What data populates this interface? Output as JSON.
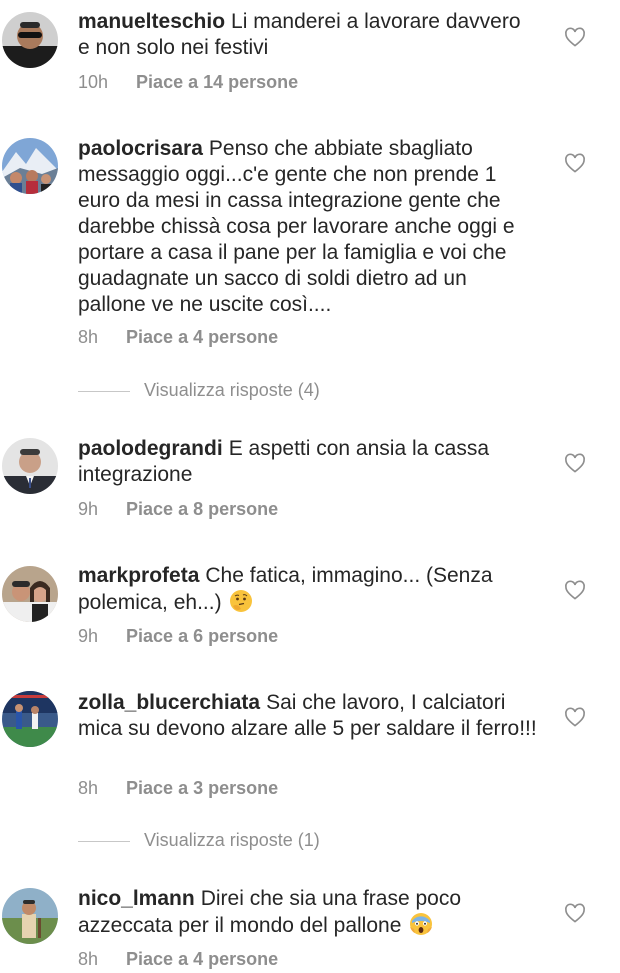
{
  "comments": [
    {
      "username": "manuelteschio",
      "text": "Li manderei a lavorare davvero e non solo nei festivi",
      "time": "10h",
      "likes": "Piace a 14 persone",
      "avatar_icon": "avatar-man-sunglasses"
    },
    {
      "username": "paolocrisara",
      "text": "Penso che abbiate sbagliato messaggio oggi...c'e gente che non prende 1 euro da mesi in cassa integrazione gente che darebbe chissà cosa per lavorare anche oggi e portare a casa il pane per la famiglia e voi che guadagnate un sacco di soldi dietro ad un pallone ve ne uscite così....",
      "time": "8h",
      "likes": "Piace a 4 persone",
      "replies": "Visualizza risposte (4)",
      "avatar_icon": "avatar-mountain-group"
    },
    {
      "username": "paolodegrandi",
      "text": "E aspetti con ansia la cassa integrazione",
      "time": "9h",
      "likes": "Piace a 8 persone",
      "avatar_icon": "avatar-man-suit"
    },
    {
      "username": "markprofeta",
      "text": "Che fatica, immagino... (Senza polemica, eh...)",
      "emoji": "thinking-face-emoji",
      "time": "9h",
      "likes": "Piace a 6 persone",
      "avatar_icon": "avatar-couple"
    },
    {
      "username": "zolla_blucerchiata",
      "text": "Sai che lavoro, I calciatori mica su devono alzare alle 5 per saldare il ferro!!!",
      "time": "8h",
      "likes": "Piace a 3 persone",
      "replies": "Visualizza risposte (1)",
      "avatar_icon": "avatar-stadium"
    },
    {
      "username": "nico_lmann",
      "text": "Direi che sia una frase poco azzeccata per il mondo del pallone",
      "emoji": "screaming-face-emoji",
      "time": "8h",
      "likes": "Piace a 4 persone",
      "avatar_icon": "avatar-man-field"
    }
  ],
  "colors": {
    "text": "#262626",
    "secondary": "#8e8e8e",
    "divider": "#c7c7c7"
  }
}
